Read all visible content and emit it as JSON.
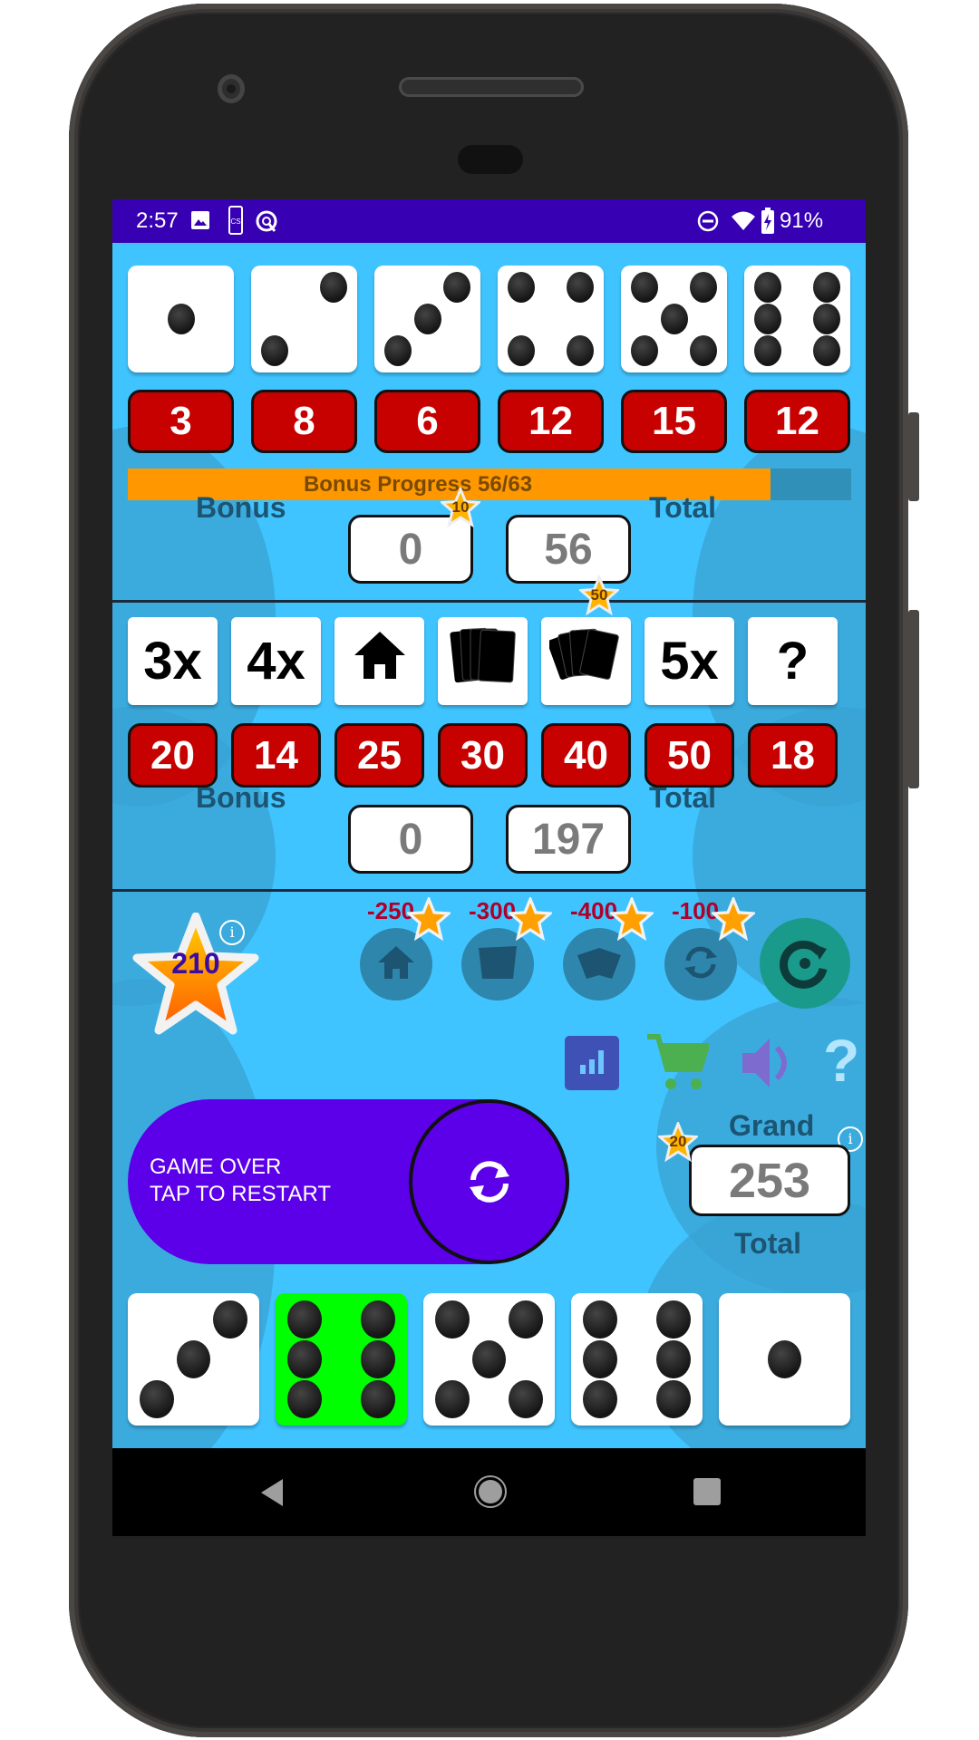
{
  "status_bar": {
    "time": "2:57",
    "left_icons": [
      "image-icon",
      "screen-capture-icon",
      "vpn-q-icon"
    ],
    "right_icons": [
      "do-not-disturb-icon",
      "wifi-icon",
      "battery-charging-icon"
    ],
    "battery": "91%"
  },
  "upper_section": {
    "dice": [
      1,
      2,
      3,
      4,
      5,
      6
    ],
    "scores": [
      "3",
      "8",
      "6",
      "12",
      "15",
      "12"
    ],
    "bonus_progress": {
      "label": "Bonus Progress 56/63",
      "current": 56,
      "target": 63
    },
    "bonus_star_badge": "10",
    "bonus_label": "Bonus",
    "bonus_value": "0",
    "total_value": "56",
    "total_label": "Total"
  },
  "lower_section": {
    "categories": [
      {
        "label": "3x",
        "icon": "three-of-a-kind"
      },
      {
        "label": "4x",
        "icon": "four-of-a-kind"
      },
      {
        "label": "",
        "icon": "house-icon"
      },
      {
        "label": "",
        "icon": "small-straight-cards-icon"
      },
      {
        "label": "",
        "icon": "large-straight-cards-icon"
      },
      {
        "label": "5x",
        "icon": "five-of-a-kind"
      },
      {
        "label": "?",
        "icon": "chance"
      }
    ],
    "scores": [
      "20",
      "14",
      "25",
      "30",
      "40",
      "50",
      "18"
    ],
    "five_kind_star_badge": "50",
    "bonus_label": "Bonus",
    "bonus_value": "0",
    "total_value": "197",
    "total_label": "Total"
  },
  "stars": {
    "count": "210",
    "info_icon": "i"
  },
  "powerups": [
    {
      "cost": "-250",
      "icon": "house-icon"
    },
    {
      "cost": "-300",
      "icon": "cards-icon"
    },
    {
      "cost": "-400",
      "icon": "cards-fan-icon"
    },
    {
      "cost": "-100",
      "icon": "reroll-icon"
    }
  ],
  "toolbar_icons": [
    "stats-icon",
    "cart-icon",
    "sound-icon",
    "help-icon"
  ],
  "restart": {
    "line1": "GAME OVER",
    "line2": "TAP TO RESTART"
  },
  "grand_total": {
    "label_top": "Grand",
    "value": "253",
    "label_bottom": "Total",
    "star_badge": "20",
    "info_icon": "i"
  },
  "roll_dice": [
    {
      "value": 3,
      "held": false
    },
    {
      "value": 6,
      "held": true
    },
    {
      "value": 5,
      "held": false
    },
    {
      "value": 6,
      "held": false
    },
    {
      "value": 1,
      "held": false
    }
  ],
  "colors": {
    "status_bar": "#3700b3",
    "background": "#40c4ff",
    "score_red": "#c70000",
    "progress_orange": "#ff9800",
    "restart_purple": "#5b00e8",
    "held_die_green": "#00ff00",
    "teal_button": "#1a9a8a"
  }
}
